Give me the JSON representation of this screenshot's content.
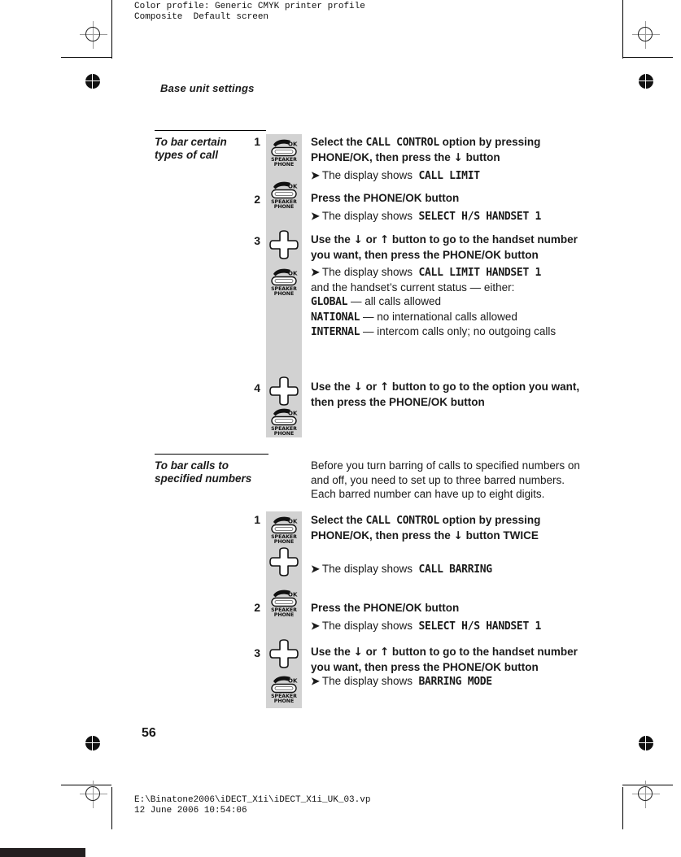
{
  "prepress": {
    "header_line1": "Color profile: Generic CMYK printer profile",
    "header_line2": "Composite  Default screen",
    "footer_line1": "E:\\Binatone2006\\iDECT_X1i\\iDECT_X1i_UK_03.vp",
    "footer_line2": "12 June 2006 10:54:06"
  },
  "page": {
    "running_head": "Base unit settings",
    "number": "56"
  },
  "sections": [
    {
      "label": "To bar certain types of call",
      "steps": [
        {
          "number": "1",
          "lines": [
            {
              "kind": "instruction",
              "html": "Select the <span class=\"lcd\">CALL CONTROL</span> option by pressing <b>PHONE/OK</b>, then press the <span class=\"navglyph\">&#8595;</span> button"
            },
            {
              "kind": "result",
              "label": "The display shows",
              "value": "CALL LIMIT"
            }
          ]
        },
        {
          "number": "2",
          "lines": [
            {
              "kind": "instruction",
              "html": "Press the <b>PHONE/OK</b> button"
            },
            {
              "kind": "result",
              "label": "The display shows",
              "value": "SELECT H/S  HANDSET 1"
            }
          ]
        },
        {
          "number": "3",
          "lines": [
            {
              "kind": "instruction",
              "html": "Use the <span class=\"navglyph\">&#8595;</span> or <span class=\"navglyph\">&#8593;</span> button to go to the handset number you want, then press the <b>PHONE/OK</b> button"
            },
            {
              "kind": "result",
              "label": "The display shows",
              "value": "CALL LIMIT HANDSET 1"
            },
            {
              "kind": "plain",
              "html": "and the handset&#8217;s current status &#8212; either:"
            },
            {
              "kind": "status",
              "value": "GLOBAL",
              "desc": "&#8212; all calls allowed"
            },
            {
              "kind": "status",
              "value": "NATIONAL",
              "desc": "&#8212; no international calls allowed"
            },
            {
              "kind": "status",
              "value": "INTERNAL",
              "desc": "&#8212; intercom calls only; no outgoing calls"
            }
          ]
        },
        {
          "number": "4",
          "lines": [
            {
              "kind": "instruction",
              "html": "Use the <span class=\"navglyph\">&#8595;</span> or <span class=\"navglyph\">&#8593;</span> button to go to the option you want, then press the <b>PHONE/OK</b> button"
            }
          ]
        }
      ]
    },
    {
      "label": "To bar calls to specified numbers",
      "intro": "Before you turn barring of calls to specified numbers on and off, you need to set up to three barred numbers. Each barred number can have up to eight digits.",
      "steps": [
        {
          "number": "1",
          "lines": [
            {
              "kind": "instruction",
              "html": "Select the <span class=\"lcd\">CALL CONTROL</span> option by pressing <b>PHONE/OK</b>, then press the <span class=\"navglyph\">&#8595;</span> button TWICE"
            },
            {
              "kind": "result",
              "label": "The display shows",
              "value": "CALL BARRING"
            }
          ]
        },
        {
          "number": "2",
          "lines": [
            {
              "kind": "instruction",
              "html": "Press the <b>PHONE/OK</b> button"
            },
            {
              "kind": "result",
              "label": "The display shows",
              "value": "SELECT H/S  HANDSET 1"
            }
          ]
        },
        {
          "number": "3",
          "lines": [
            {
              "kind": "instruction",
              "html": "Use the <span class=\"navglyph\">&#8595;</span> or <span class=\"navglyph\">&#8593;</span> button to go to the handset number you want, then press the <b>PHONE/OK</b> button"
            },
            {
              "kind": "result",
              "label": "The display shows",
              "value": "BARRING MODE"
            }
          ]
        }
      ]
    }
  ],
  "pictograms": {
    "speakerphone_label_top": "SPEAKER",
    "speakerphone_label_bottom": "PHONE",
    "ok_label": "OK"
  },
  "colors": {
    "icon_strip": "#d2d2d2",
    "text": "#1a1a1a",
    "rule": "#000000"
  }
}
